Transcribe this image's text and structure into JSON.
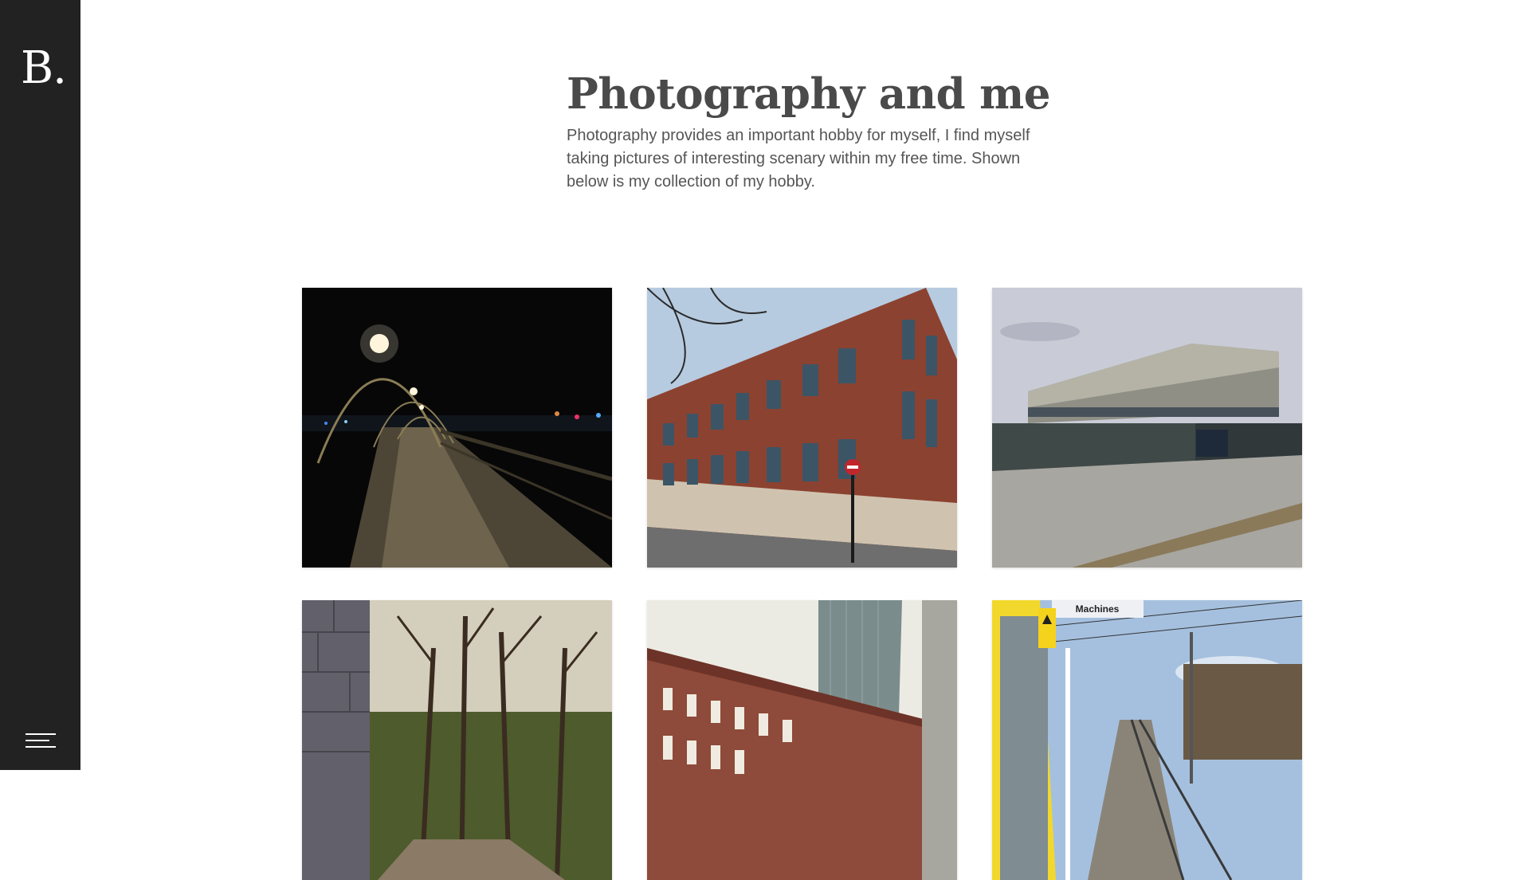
{
  "sidebar": {
    "logo_text": "B.",
    "menu_icon": "hamburger-menu-icon"
  },
  "header": {
    "title": "Photography and me",
    "intro": "Photography provides an important hobby for myself, I find myself taking pictures of interesting scenary within my free time. Shown below is my collection of my hobby."
  },
  "gallery": {
    "photos": [
      {
        "subject": "pier-at-night"
      },
      {
        "subject": "brick-office-building"
      },
      {
        "subject": "modern-building-construction"
      },
      {
        "subject": "wooded-path"
      },
      {
        "subject": "victorian-terrace-and-tower"
      },
      {
        "subject": "railway-station-platform",
        "sign_text": "Machines"
      }
    ]
  },
  "colors": {
    "sidebar_bg": "#222222",
    "title": "#4a4a4a",
    "body_text": "#555555"
  }
}
